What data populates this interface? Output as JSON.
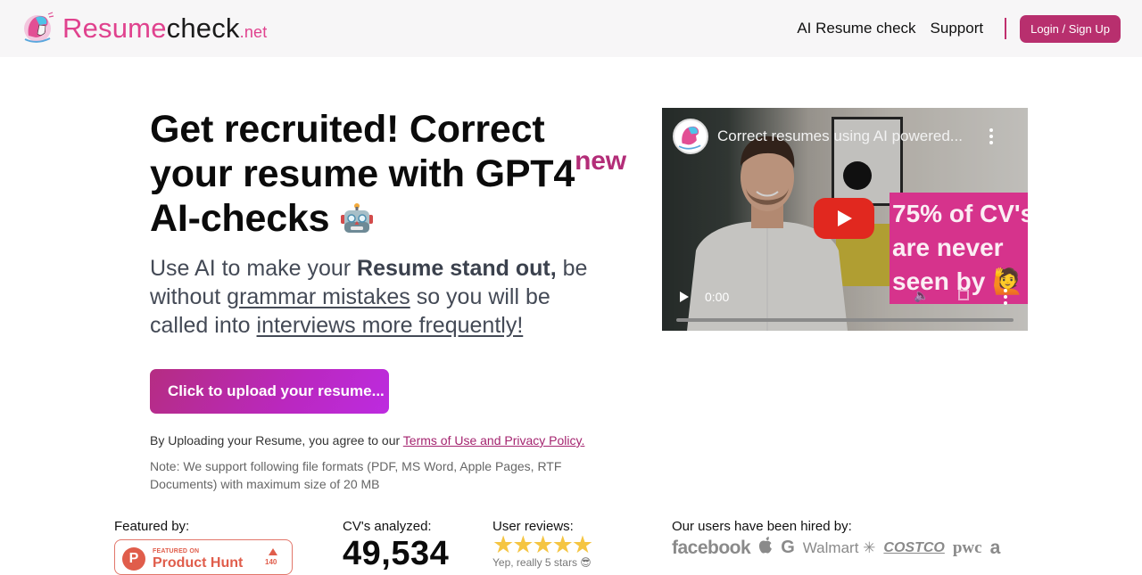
{
  "header": {
    "logo": {
      "part1": "Resume",
      "part2": "check",
      "part3": ".net"
    },
    "nav": [
      {
        "label": "AI Resume check"
      },
      {
        "label": "Support"
      }
    ],
    "login_label": "Login / Sign Up"
  },
  "hero": {
    "title_part1": "Get recruited! Correct your resume with GPT4",
    "title_sup": "new",
    "title_part2": " AI-checks",
    "title_emoji": "robot-face",
    "subtitle": {
      "s1": "Use AI to make your ",
      "bold": "Resume stand out,",
      "s2": " be without ",
      "link1": "grammar mistakes",
      "s3": " so you will be called into ",
      "link2": "interviews more frequently!"
    },
    "upload_label": "Click to upload your resume...",
    "agree_text": "By Uploading your Resume, you agree to our ",
    "agree_link": "Terms of Use and Privacy Policy.",
    "note": "Note: We support following file formats (PDF, MS Word, Apple Pages, RTF Documents) with maximum size of 20 MB"
  },
  "video": {
    "title": "Correct resumes using AI powered...",
    "overlay_lines": [
      "75% of CV's",
      "are never",
      "seen by 🙋"
    ],
    "time": "0:00",
    "progress": 0
  },
  "stats": {
    "featured_label": "Featured by:",
    "ph_featured_on": "FEATURED ON",
    "ph_name": "Product Hunt",
    "ph_count": "140",
    "cv_label": "CV's analyzed:",
    "cv_count": "49,534",
    "reviews_label": "User reviews:",
    "stars": 5,
    "reviews_note": "Yep, really 5 stars 😎",
    "hired_label": "Our users have been hired by:",
    "hired_logos": [
      "facebook",
      "",
      "G",
      "Walmart ✳",
      "COSTCO",
      "pwc",
      "a"
    ]
  },
  "colors": {
    "brand_pink": "#e0428e",
    "button": "#b82f6e",
    "upload_gradient_start": "#b52d82",
    "upload_gradient_end": "#bd2be0",
    "star": "#f5c542"
  }
}
